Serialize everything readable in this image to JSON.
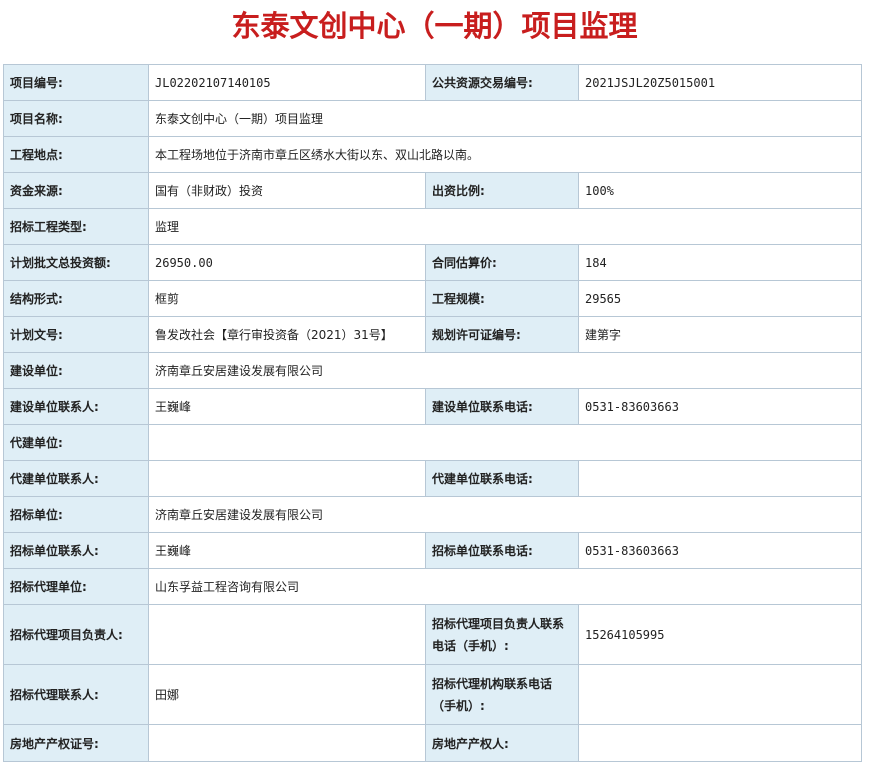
{
  "page_title": "东泰文创中心（一期）项目监理",
  "fields": {
    "project_no": {
      "label": "项目编号:",
      "value": "JL02202107140105"
    },
    "trade_no": {
      "label": "公共资源交易编号:",
      "value": "2021JSJL20Z5015001"
    },
    "project_name": {
      "label": "项目名称:",
      "value": "东泰文创中心（一期）项目监理"
    },
    "location": {
      "label": "工程地点:",
      "value": "本工程场地位于济南市章丘区绣水大街以东、双山北路以南。"
    },
    "fund_source": {
      "label": "资金来源:",
      "value": "国有（非财政）投资"
    },
    "fund_ratio": {
      "label": "出资比例:",
      "value": "100%"
    },
    "bid_type": {
      "label": "招标工程类型:",
      "value": "监理"
    },
    "total_invest": {
      "label": "计划批文总投资额:",
      "value": "26950.00"
    },
    "contract_price": {
      "label": "合同估算价:",
      "value": "184"
    },
    "structure": {
      "label": "结构形式:",
      "value": "框剪"
    },
    "scale": {
      "label": "工程规模:",
      "value": "29565"
    },
    "plan_doc": {
      "label": "计划文号:",
      "value": "鲁发改社会【章行审投资备（2021）31号】"
    },
    "permit_no": {
      "label": "规划许可证编号:",
      "value": "建第字"
    },
    "builder": {
      "label": "建设单位:",
      "value": "济南章丘安居建设发展有限公司"
    },
    "builder_contact": {
      "label": "建设单位联系人:",
      "value": "王巍峰"
    },
    "builder_phone": {
      "label": "建设单位联系电话:",
      "value": "0531-83603663"
    },
    "agent_builder": {
      "label": "代建单位:",
      "value": ""
    },
    "agent_builder_contact": {
      "label": "代建单位联系人:",
      "value": ""
    },
    "agent_builder_phone": {
      "label": "代建单位联系电话:",
      "value": ""
    },
    "tenderer": {
      "label": "招标单位:",
      "value": "济南章丘安居建设发展有限公司"
    },
    "tenderer_contact": {
      "label": "招标单位联系人:",
      "value": "王巍峰"
    },
    "tenderer_phone": {
      "label": "招标单位联系电话:",
      "value": "0531-83603663"
    },
    "tender_agent": {
      "label": "招标代理单位:",
      "value": "山东孚益工程咨询有限公司"
    },
    "agent_pm": {
      "label": "招标代理项目负责人:",
      "value": ""
    },
    "agent_pm_phone": {
      "label": "招标代理项目负责人联系电话（手机）:",
      "value": "15264105995"
    },
    "agent_contact": {
      "label": "招标代理联系人:",
      "value": "田娜"
    },
    "agent_org_phone": {
      "label": "招标代理机构联系电话（手机）:",
      "value": ""
    },
    "property_cert": {
      "label": "房地产产权证号:",
      "value": ""
    },
    "property_owner": {
      "label": "房地产产权人:",
      "value": ""
    }
  }
}
